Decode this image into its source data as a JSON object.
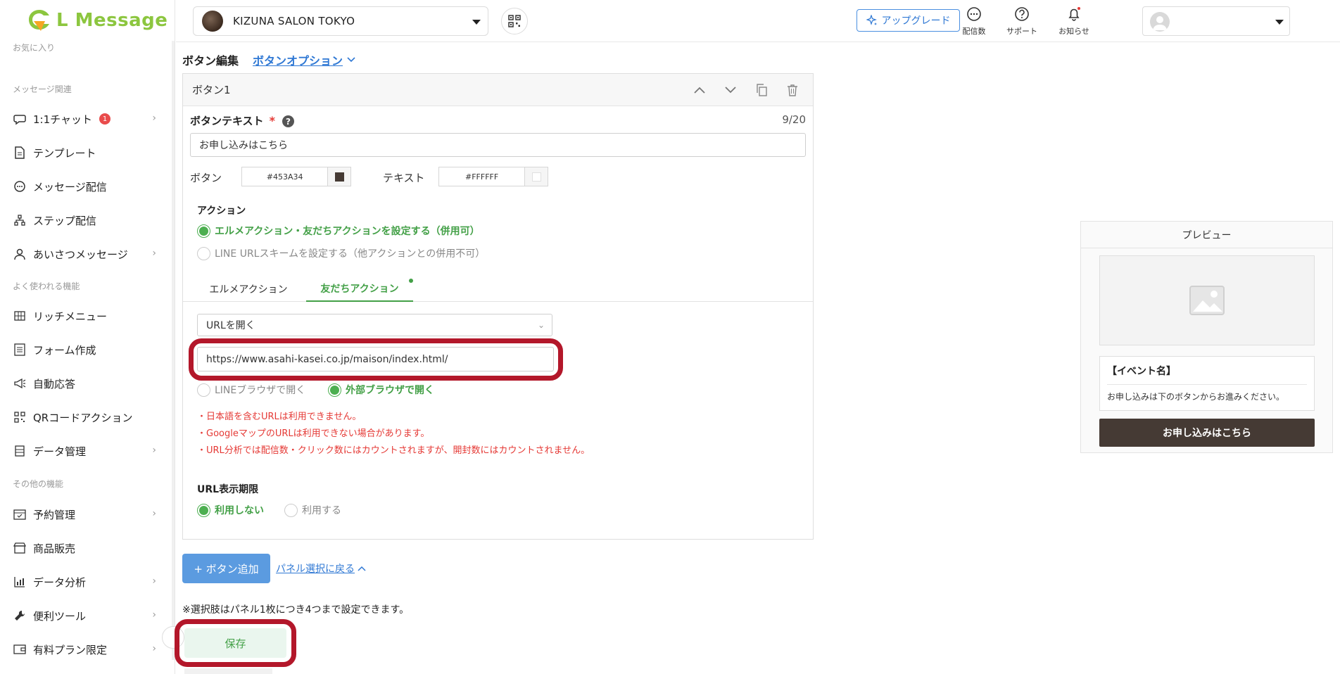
{
  "brand": {
    "name": "L Message",
    "accent": "#8cc63f"
  },
  "sidebar": {
    "sections": {
      "favorites": "お気に入り",
      "messages": "メッセージ関連",
      "frequent": "よく使われる機能",
      "other": "その他の機能"
    },
    "items": [
      {
        "label": "1:1チャット",
        "icon": "chat-icon",
        "badge": "1",
        "chevron": true
      },
      {
        "label": "テンプレート",
        "icon": "document-icon"
      },
      {
        "label": "メッセージ配信",
        "icon": "message-icon"
      },
      {
        "label": "ステップ配信",
        "icon": "step-icon"
      },
      {
        "label": "あいさつメッセージ",
        "icon": "person-icon",
        "chevron": true
      },
      {
        "label": "リッチメニュー",
        "icon": "grid-icon"
      },
      {
        "label": "フォーム作成",
        "icon": "form-icon"
      },
      {
        "label": "自動応答",
        "icon": "megaphone-icon"
      },
      {
        "label": "QRコードアクション",
        "icon": "qr-icon"
      },
      {
        "label": "データ管理",
        "icon": "list-icon",
        "chevron": true
      },
      {
        "label": "予約管理",
        "icon": "calendar-icon",
        "chevron": true
      },
      {
        "label": "商品販売",
        "icon": "shop-icon"
      },
      {
        "label": "データ分析",
        "icon": "chart-icon",
        "chevron": true
      },
      {
        "label": "便利ツール",
        "icon": "wrench-icon",
        "chevron": true
      },
      {
        "label": "有料プラン限定",
        "icon": "wallet-icon",
        "chevron": true
      }
    ]
  },
  "header": {
    "account_name": "KIZUNA SALON TOKYO",
    "upgrade_label": "アップグレード",
    "icons": [
      {
        "label": "配信数",
        "icon": "chat-bubble-icon"
      },
      {
        "label": "サポート",
        "icon": "help-circle-icon"
      },
      {
        "label": "お知らせ",
        "icon": "bell-icon"
      }
    ]
  },
  "editor": {
    "title": "ボタン編集",
    "options_link": "ボタンオプション",
    "panel_title": "ボタン1",
    "button_text_label": "ボタンテキスト",
    "required_mark": "*",
    "counter": "9/20",
    "button_text_value": "お申し込みはこちら",
    "button_color_label": "ボタン",
    "button_color": "#453A34",
    "text_color_label": "テキスト",
    "text_color": "#FFFFFF",
    "action_label": "アクション",
    "action_options": [
      {
        "label": "エルメアクション・友だちアクションを設定する（併用可）",
        "selected": true
      },
      {
        "label": "LINE URLスキームを設定する（他アクションとの併用不可）",
        "selected": false
      }
    ],
    "tabs": [
      {
        "label": "エルメアクション",
        "active": false
      },
      {
        "label": "友だちアクション",
        "active": true
      }
    ],
    "action_type": "URLを開く",
    "url_value": "https://www.asahi-kasei.co.jp/maison/index.html/",
    "browser_options": [
      {
        "label": "LINEブラウザで開く",
        "selected": false
      },
      {
        "label": "外部ブラウザで開く",
        "selected": true
      }
    ],
    "warnings": [
      "・日本語を含むURLは利用できません。",
      "・GoogleマップのURLは利用できない場合があります。",
      "・URL分析では配信数・クリック数にはカウントされますが、開封数にはカウントされません。"
    ],
    "url_period_label": "URL表示期限",
    "url_period_options": [
      {
        "label": "利用しない",
        "selected": true
      },
      {
        "label": "利用する",
        "selected": false
      }
    ],
    "add_button_label": "+ ボタン追加",
    "back_link": "パネル選択に戻る",
    "note": "※選択肢はパネル1枚につき4つまで設定できます。",
    "save_label": "保存"
  },
  "preview": {
    "title": "プレビュー",
    "card_title": "【イベント名】",
    "card_body": "お申し込みは下のボタンからお進みください。",
    "button_label": "お申し込みはこちら",
    "button_color": "#453A34"
  },
  "colors": {
    "highlight": "#b3172a",
    "green": "#43a047",
    "link": "#2f78d4"
  }
}
